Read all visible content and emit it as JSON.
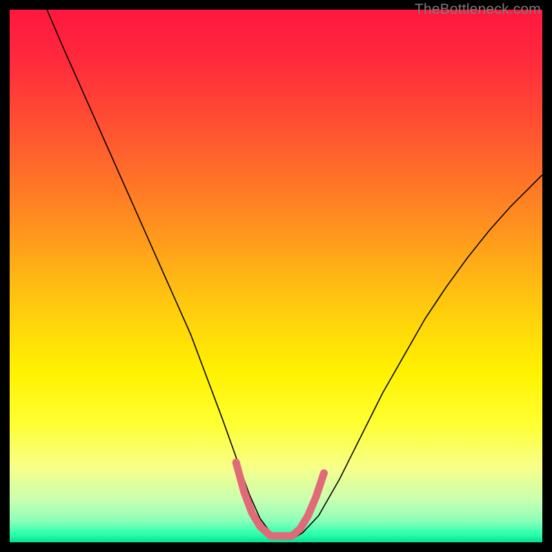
{
  "watermark": "TheBottleneck.com",
  "chart_data": {
    "type": "line",
    "title": "",
    "xlabel": "",
    "ylabel": "",
    "xlim": [
      0,
      100
    ],
    "ylim": [
      0,
      100
    ],
    "grid": false,
    "background_gradient": {
      "stops": [
        {
          "pos": 0.0,
          "color": "#ff173f"
        },
        {
          "pos": 0.1,
          "color": "#ff2b3c"
        },
        {
          "pos": 0.25,
          "color": "#ff5b2f"
        },
        {
          "pos": 0.4,
          "color": "#ff8f1f"
        },
        {
          "pos": 0.55,
          "color": "#ffc80f"
        },
        {
          "pos": 0.68,
          "color": "#fff200"
        },
        {
          "pos": 0.78,
          "color": "#ffff33"
        },
        {
          "pos": 0.86,
          "color": "#f7ff8a"
        },
        {
          "pos": 0.92,
          "color": "#c9ffb0"
        },
        {
          "pos": 0.96,
          "color": "#8affb8"
        },
        {
          "pos": 0.985,
          "color": "#2affad"
        },
        {
          "pos": 1.0,
          "color": "#07e090"
        }
      ]
    },
    "series": [
      {
        "name": "bottleneck-curve",
        "stroke": "#000000",
        "stroke_width": 1.6,
        "x": [
          7,
          10,
          14,
          18,
          22,
          26,
          30,
          34,
          37,
          40,
          42.5,
          45,
          47,
          49,
          51,
          53,
          55,
          58,
          62,
          66,
          70,
          74,
          78,
          82,
          86,
          90,
          94,
          98,
          100
        ],
        "y": [
          100,
          93,
          84,
          75,
          66,
          57,
          48,
          39,
          31,
          23,
          16,
          9,
          4.5,
          1.8,
          0.6,
          0.6,
          1.8,
          5,
          12,
          20,
          28,
          35,
          42,
          48,
          53.5,
          58.5,
          63,
          67,
          69
        ]
      },
      {
        "name": "optimal-zone-marker",
        "stroke": "#e06a78",
        "stroke_width": 11,
        "linecap": "round",
        "x": [
          42.5,
          44,
          45.5,
          47,
          49,
          51,
          53,
          54.5,
          56,
          57.5,
          59
        ],
        "y": [
          15,
          9.5,
          5.5,
          3,
          1.2,
          1.2,
          1.2,
          2.5,
          5,
          8.5,
          13
        ]
      }
    ]
  }
}
